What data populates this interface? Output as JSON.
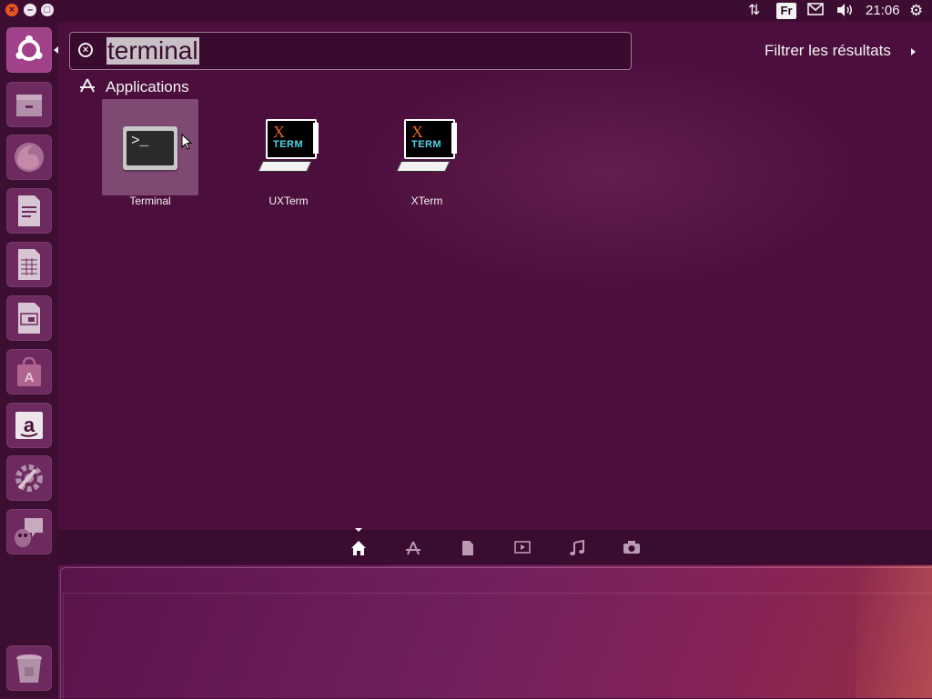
{
  "top_panel": {
    "window_buttons": [
      "close",
      "minimize",
      "maximize"
    ],
    "network_icon": "network-updown-icon",
    "keyboard_layout": "Fr",
    "mail_icon": "mail-icon",
    "sound_icon": "volume-icon",
    "clock": "21:06",
    "power_icon": "gear-icon"
  },
  "launcher": {
    "items": [
      {
        "name": "ubuntu-dash-button",
        "icon": "ubuntu-logo-icon"
      },
      {
        "name": "files",
        "icon": "file-cabinet-icon"
      },
      {
        "name": "firefox",
        "icon": "firefox-icon"
      },
      {
        "name": "libreoffice-writer",
        "icon": "writer-document-icon"
      },
      {
        "name": "libreoffice-calc",
        "icon": "calc-spreadsheet-icon"
      },
      {
        "name": "libreoffice-impress",
        "icon": "impress-presentation-icon"
      },
      {
        "name": "ubuntu-software-center",
        "icon": "software-center-bag-icon"
      },
      {
        "name": "amazon",
        "icon": "amazon-icon"
      },
      {
        "name": "system-settings",
        "icon": "settings-wrench-icon"
      },
      {
        "name": "empathy",
        "icon": "chat-bubble-icon"
      },
      {
        "name": "trash",
        "icon": "trash-icon"
      }
    ]
  },
  "dash": {
    "search": {
      "value": "terminal",
      "clear_icon": "clear-circle-icon"
    },
    "filter_results": "Filtrer les résultats",
    "category": {
      "icon": "applications-icon",
      "title": "Applications"
    },
    "results": [
      {
        "label": "Terminal",
        "icon": "terminal-icon",
        "selected": true
      },
      {
        "label": "UXTerm",
        "icon": "xterm-icon",
        "selected": false
      },
      {
        "label": "XTerm",
        "icon": "xterm-icon",
        "selected": false
      }
    ],
    "lenses": [
      {
        "name": "home",
        "icon": "home-icon",
        "active": true
      },
      {
        "name": "applications",
        "icon": "applications-icon",
        "active": false
      },
      {
        "name": "files",
        "icon": "file-icon",
        "active": false
      },
      {
        "name": "videos",
        "icon": "video-icon",
        "active": false
      },
      {
        "name": "music",
        "icon": "music-note-icon",
        "active": false
      },
      {
        "name": "photos",
        "icon": "camera-icon",
        "active": false
      }
    ],
    "xterm_logo": {
      "x": "X",
      "term": "TERM"
    },
    "terminal_prompt": ">_"
  },
  "colors": {
    "panel": "#3d0c31",
    "dash_bg": "#4c0f3d",
    "accent": "#e95420",
    "selected_tile": "#7f4a72"
  }
}
